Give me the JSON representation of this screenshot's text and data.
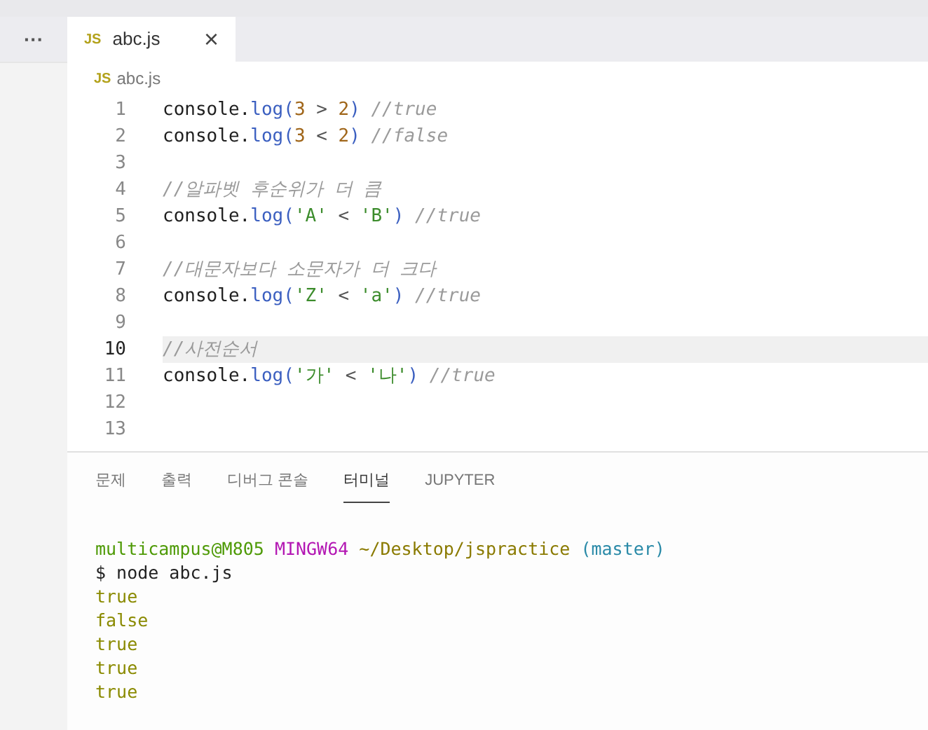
{
  "toolbar": {
    "more": "···"
  },
  "tabs": [
    {
      "icon": "JS",
      "label": "abc.js",
      "selected": true,
      "close": "×"
    }
  ],
  "breadcrumb": {
    "icon": "JS",
    "label": "abc.js"
  },
  "editor": {
    "lines": [
      {
        "number": "1",
        "current": false,
        "tokens": [
          {
            "kind": "plain",
            "text": "console."
          },
          {
            "kind": "func",
            "text": "log("
          },
          {
            "kind": "number",
            "text": "3"
          },
          {
            "kind": "op",
            "text": " > "
          },
          {
            "kind": "number",
            "text": "2"
          },
          {
            "kind": "func",
            "text": ")"
          },
          {
            "kind": "comment",
            "text": " //true"
          }
        ]
      },
      {
        "number": "2",
        "current": false,
        "tokens": [
          {
            "kind": "plain",
            "text": "console."
          },
          {
            "kind": "func",
            "text": "log("
          },
          {
            "kind": "number",
            "text": "3"
          },
          {
            "kind": "op",
            "text": " < "
          },
          {
            "kind": "number",
            "text": "2"
          },
          {
            "kind": "func",
            "text": ")"
          },
          {
            "kind": "comment",
            "text": " //false"
          }
        ]
      },
      {
        "number": "3",
        "current": false
      },
      {
        "number": "4",
        "current": false,
        "tokens": [
          {
            "kind": "comment",
            "text": "//알파벳 후순위가 더 큼"
          }
        ]
      },
      {
        "number": "5",
        "current": false,
        "tokens": [
          {
            "kind": "plain",
            "text": "console."
          },
          {
            "kind": "func",
            "text": "log("
          },
          {
            "kind": "string",
            "text": "'A'"
          },
          {
            "kind": "op",
            "text": " < "
          },
          {
            "kind": "string",
            "text": "'B'"
          },
          {
            "kind": "func",
            "text": ")"
          },
          {
            "kind": "comment",
            "text": " //true"
          }
        ]
      },
      {
        "number": "6",
        "current": false
      },
      {
        "number": "7",
        "current": false,
        "tokens": [
          {
            "kind": "comment",
            "text": "//대문자보다 소문자가 더 크다"
          }
        ]
      },
      {
        "number": "8",
        "current": false,
        "tokens": [
          {
            "kind": "plain",
            "text": "console."
          },
          {
            "kind": "func",
            "text": "log("
          },
          {
            "kind": "string",
            "text": "'Z'"
          },
          {
            "kind": "op",
            "text": " < "
          },
          {
            "kind": "string",
            "text": "'a'"
          },
          {
            "kind": "func",
            "text": ")"
          },
          {
            "kind": "comment",
            "text": " //true"
          }
        ]
      },
      {
        "number": "9",
        "current": false
      },
      {
        "number": "10",
        "current": true,
        "tokens": [
          {
            "kind": "comment",
            "text": "//사전순서"
          }
        ]
      },
      {
        "number": "11",
        "current": false,
        "tokens": [
          {
            "kind": "plain",
            "text": "console."
          },
          {
            "kind": "func",
            "text": "log("
          },
          {
            "kind": "string",
            "text": "'가'"
          },
          {
            "kind": "op",
            "text": " < "
          },
          {
            "kind": "string",
            "text": "'나'"
          },
          {
            "kind": "func",
            "text": ")"
          },
          {
            "kind": "comment",
            "text": " //true"
          }
        ]
      },
      {
        "number": "12",
        "current": false
      },
      {
        "number": "13",
        "current": false
      }
    ]
  },
  "panel": {
    "tabs": [
      {
        "label": "문제",
        "selected": false
      },
      {
        "label": "출력",
        "selected": false
      },
      {
        "label": "디버그 콘솔",
        "selected": false
      },
      {
        "label": "터미널",
        "selected": true
      },
      {
        "label": "JUPYTER",
        "selected": false
      }
    ],
    "terminal": [
      [
        {
          "kind": "user",
          "text": "multicampus@M805"
        },
        {
          "kind": "env",
          "text": " MINGW64"
        },
        {
          "kind": "path",
          "text": " ~/Desktop/jspractice"
        },
        {
          "kind": "branch",
          "text": " (master)"
        }
      ],
      [
        {
          "kind": "command",
          "text": "$ node abc.js"
        }
      ],
      [
        {
          "kind": "output",
          "text": "true"
        }
      ],
      [
        {
          "kind": "output",
          "text": "false"
        }
      ],
      [
        {
          "kind": "output",
          "text": "true"
        }
      ],
      [
        {
          "kind": "output",
          "text": "true"
        }
      ],
      [
        {
          "kind": "output",
          "text": "true"
        }
      ]
    ]
  }
}
